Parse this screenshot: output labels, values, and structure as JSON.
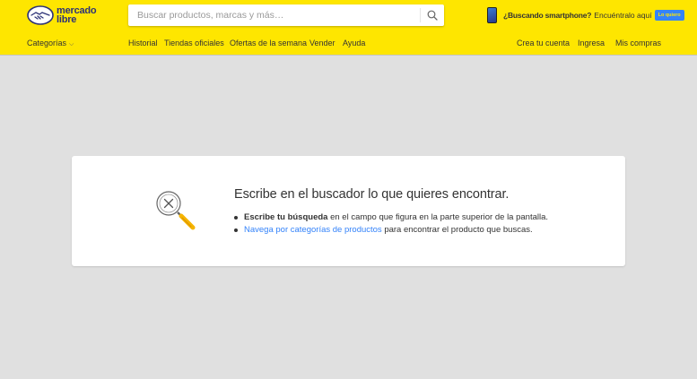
{
  "brand": {
    "line1": "mercado",
    "line2": "libre",
    "color": "#2d3277",
    "accent": "#fee600"
  },
  "search": {
    "placeholder": "Buscar productos, marcas y más…",
    "value": "",
    "icon": "search-icon"
  },
  "promo": {
    "bold": "¿Buscando smartphone?",
    "text": "Encuéntralo aquí",
    "cta": "Lo quiero",
    "icon": "smartphone-icon"
  },
  "nav": {
    "categories": "Categorías",
    "links": [
      "Historial",
      "Tiendas oficiales",
      "Ofertas de la semana",
      "Vender",
      "Ayuda"
    ],
    "account": [
      "Crea tu cuenta",
      "Ingresa",
      "Mis compras"
    ]
  },
  "empty_state": {
    "icon": "search-not-found-icon",
    "title": "Escribe en el buscador lo que quieres encontrar.",
    "item1_bold": "Escribe tu búsqueda",
    "item1_rest": " en el campo que figura en la parte superior de la pantalla.",
    "item2_link": "Navega por categorías de productos",
    "item2_rest": " para encontrar el producto que buscas.",
    "link_color": "#3483fa"
  }
}
